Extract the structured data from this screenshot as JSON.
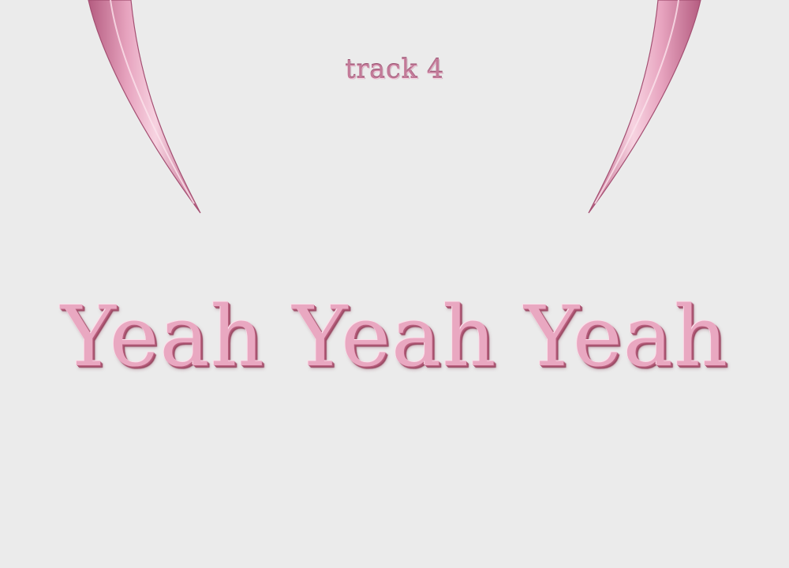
{
  "track": {
    "label": "track 4"
  },
  "title": {
    "text": "Yeah Yeah Yeah"
  },
  "decorations": {
    "left_icon": "horn-icon",
    "right_icon": "horn-icon"
  },
  "colors": {
    "background": "#ebebeb",
    "accent_pink": "#e9a8c1",
    "dark_pink": "#a9526f",
    "label_pink": "#c27a98"
  }
}
